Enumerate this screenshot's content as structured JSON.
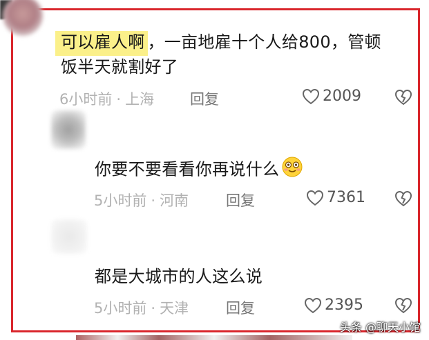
{
  "comments": [
    {
      "highlight": "可以雇人啊",
      "text_line1": "，一亩地雇十个人给800，管顿",
      "text_line2": "饭半天就割好了",
      "time": "6小时前",
      "location": "上海",
      "reply_label": "回复",
      "likes": "2009"
    },
    {
      "text": "你要不要看看你再说什么",
      "emoji": "smiling-face-icon",
      "time": "5小时前",
      "location": "河南",
      "reply_label": "回复",
      "likes": "7361"
    },
    {
      "text": "都是大城市的人这么说",
      "time": "5小时前",
      "location": "天津",
      "reply_label": "回复",
      "likes": "2395"
    }
  ],
  "separator": "·",
  "watermark": "头条 @聊天小馆",
  "colors": {
    "frame": "#d9262c",
    "highlight": "#fbf08a",
    "meta": "#b2b2b2"
  }
}
